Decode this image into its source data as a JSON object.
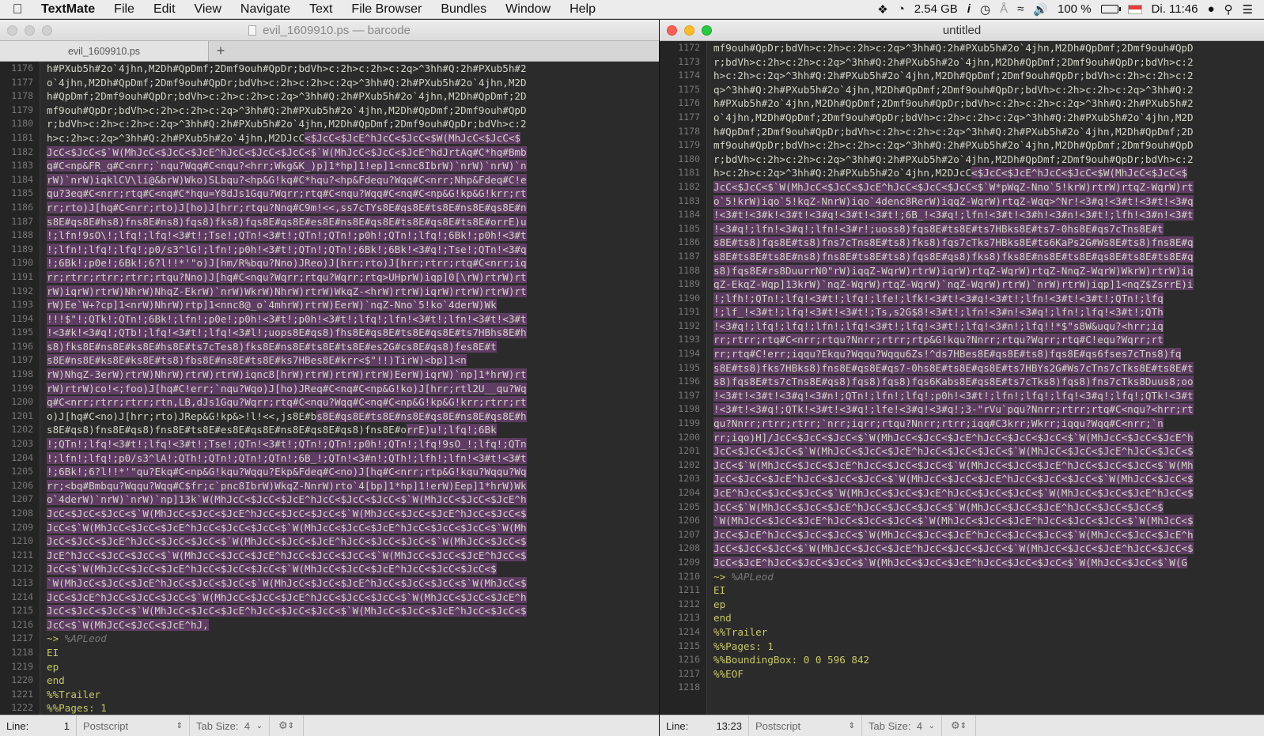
{
  "menubar": {
    "apple": "",
    "app_name": "TextMate",
    "items": [
      "File",
      "Edit",
      "View",
      "Navigate",
      "Text",
      "File Browser",
      "Bundles",
      "Window",
      "Help"
    ],
    "status": {
      "memory": "2.54 GB",
      "battery_pct": "100 %",
      "clock": "Di. 11:46"
    }
  },
  "left_window": {
    "title": "evil_1609910.ps — barcode",
    "tab_label": "evil_1609910.ps",
    "tab_add": "+",
    "line_numbers": [
      "1176",
      "1177",
      "1178",
      "1179",
      "1180",
      "1181",
      "1182",
      "1183",
      "1184",
      "1185",
      "1186",
      "1187",
      "1188",
      "1189",
      "1190",
      "1191",
      "1192",
      "1193",
      "1194",
      "1195",
      "1196",
      "1197",
      "1198",
      "1199",
      "1200",
      "1201",
      "1202",
      "1203",
      "1204",
      "1205",
      "1206",
      "1207",
      "1208",
      "1209",
      "1210",
      "1211",
      "1212",
      "1213",
      "1214",
      "1215",
      "1216",
      "1217",
      "1218",
      "1219",
      "1220",
      "1221",
      "1222"
    ],
    "lines": [
      {
        "t": "h#PXub5h#2o`4jhn,M2Dh#QpDmf;2Dmf9ouh#QpDr;bdVh>c:2h>c:2h>c:2q>^3hh#Q:2h#PXub5h#2",
        "k": "n"
      },
      {
        "t": "o`4jhn,M2Dh#QpDmf;2Dmf9ouh#QpDr;bdVh>c:2h>c:2h>c:2q>^3hh#Q:2h#PXub5h#2o`4jhn,M2D",
        "k": "n"
      },
      {
        "t": "h#QpDmf;2Dmf9ouh#QpDr;bdVh>c:2h>c:2h>c:2q>^3hh#Q:2h#PXub5h#2o`4jhn,M2Dh#QpDmf;2D",
        "k": "n"
      },
      {
        "t": "mf9ouh#QpDr;bdVh>c:2h>c:2h>c:2q>^3hh#Q:2h#PXub5h#2o`4jhn,M2Dh#QpDmf;2Dmf9ouh#QpD",
        "k": "n"
      },
      {
        "t": "r;bdVh>c:2h>c:2h>c:2q>^3hh#Q:2h#PXub5h#2o`4jhn,M2Dh#QpDmf;2Dmf9ouh#QpDr;bdVh>c:2",
        "k": "n"
      },
      {
        "t": "h>c:2h>c:2q>^3hh#Q:2h#PXub5h#2o`4jhn,M2DJcC<$JcC<$JcE^hJcC<$JcC<$W(MhJcC<$JcC<$",
        "k": "p",
        "s": 43
      },
      {
        "t": "JcC<$JcC<$`W(MhJcC<$JcC<$JcE^hJcC<$JcC<$JcC<$`W(MhJcC<$JcC<$JcE^hdJrtAq#C*hq#Bmb",
        "k": "s"
      },
      {
        "t": "q#C<np&FR_q#C<nrr;`nqu?Wqq#C<nqu?<hrr;Wkg&K_)p]1*hp]1!ep]1<nnc8IbrW)`nrW)`nrW)`n",
        "k": "s"
      },
      {
        "t": "rW)`nrW)iqklCV\\li@&brW)Wko)SLbqu?<hp&G!kq#C*hqu?<hp&Fdequ?Wqq#C<nrr;Nhp&Fdeq#C!e",
        "k": "s"
      },
      {
        "t": "qu?3eq#C<nrr;rtq#C<nq#C*hqu=Y8dJs1Gqu?Wqrr;rtq#C<nqu?Wqq#C<nq#C<np&G!kp&G!krr;rt",
        "k": "s"
      },
      {
        "t": "rr;rto)J[hq#C<nrr;rto)J[ho)J[hrr;rtqu?Nnq#C9m!<<,ss7cTYs8E#qs8E#ts8E#ns8E#qs8E#n",
        "k": "s"
      },
      {
        "t": "s8E#qs8E#hs8)fns8E#ns8)fqs8)fks8)fqs8E#qs8E#es8E#ns8E#qs8E#ts8E#qs8E#ts8E#orrE)u",
        "k": "s"
      },
      {
        "t": "!;lfn!9sO\\!;lfq!;lfq!<3#t!;Tse!;QTn!<3#t!;QTn!;QTn!;p0h!;QTn!;lfq!;6Bk!;p0h!<3#t",
        "k": "s"
      },
      {
        "t": "!;lfn!;lfq!;lfq!;p0/s3^lG!;lfn!;p0h!<3#t!;QTn!;QTn!;6Bk!;6Bk!<3#q!;Tse!;QTn!<3#q",
        "k": "s"
      },
      {
        "t": "!;6Bk!;p0e!;6Bk!;6?l!!*'\"o)J[hm/R%bqu?Nno)JReo)J[hrr;rto)J[hrr;rtrr;rtq#C<nrr;iq",
        "k": "s"
      },
      {
        "t": "rr;rtrr;rtrr;rtrr;rtqu?Nno)J[hq#C<nqu?Wqrr;rtqu?Wqrr;rtq>UHprW)iqp]0[\\rW)rtrW)rt",
        "k": "s"
      },
      {
        "t": "rW)iqrW)rtrW)NhrW)NhqZ-EkrW)`nrW)WkrW)NhrW)rtrW)WkqZ-<hrW)rtrW)iqrW)rtrW)rtrW)rt",
        "k": "s"
      },
      {
        "t": "rW)Ee`W+?cp]1<nrW)NhrW)rtp]1<nnc8@_o`4mhrW)rtrW)EerW)`nqZ-Nno`5!ko`4derW)Wk",
        "k": "s"
      },
      {
        "t": "!!!$\"!;QTk!;QTn!;6Bk!;lfn!;p0e!;p0h!<3#t!;p0h!<3#t!;lfq!;lfn!<3#t!;lfn!<3#t!<3#t",
        "k": "s"
      },
      {
        "t": "!<3#k!<3#q!;QTb!;lfq!<3#t!;lfq!<3#l!;uops8E#qs8)fhs8E#qs8E#ts8E#qs8E#ts7HBhs8E#h",
        "k": "s"
      },
      {
        "t": "s8)fks8E#ns8E#ks8E#hs8E#ts7cTes8)fks8E#ns8E#ts8E#ts8E#es2G#cs8E#qs8)fes8E#t",
        "k": "s"
      },
      {
        "t": "s8E#ns8E#ks8E#ks8E#ts8)fbs8E#ns8E#ts8E#ks7HBes8E#krr<$\"!!)TirW)<bp]1<n",
        "k": "s"
      },
      {
        "t": "rW)NhqZ-3erW)rtrW)NhrW)rtrW)rtrW)iqnc8[hrW)rtrW)rtrW)rtrW)EerW)iqrW)`np]1*hrW)rt",
        "k": "s"
      },
      {
        "t": "rW)rtrW)co!<;foo)J[hq#C!err;`nqu?Wqo)J[ho)JReq#C<nq#C<np&G!ko)J[hrr;rtl2U__qu?Wq",
        "k": "s"
      },
      {
        "t": "q#C<nrr;rtrr;rtrr;rtn,LB,dJs1Gqu?Wqrr;rtq#C<nqu?Wqq#C<nq#C<np&G!kp&G!krr;rtrr;rt",
        "k": "s"
      },
      {
        "t": "o)J[hq#C<no)J[hrr;rto)JRep&G!kp&>!l!<<,js8E#bs8E#qs8E#ts8E#ns8E#qs8E#ns8E#qs8E#h",
        "k": "p",
        "s": 45
      },
      {
        "t": "s8E#qs8)fns8E#qs8)fns8E#ts8E#es8E#qs8E#ns8E#qs8E#qs8)fns8E#orrE)u!;lfq!;6Bk",
        "k": "p",
        "s": 60
      },
      {
        "t": "!;QTn!;lfq!<3#t!;lfq!<3#t!;Tse!;QTn!<3#t!;QTn!;QTn!;p0h!;QTn!;lfq!9sO_!;lfq!;QTn",
        "k": "s"
      },
      {
        "t": "!;lfn!;lfq!;p0/s3^lA!;QTh!;QTn!;QTn!;QTn!;6B_!;QTn!<3#n!;QTh!;lfh!;lfn!<3#t!<3#t",
        "k": "s"
      },
      {
        "t": "!;6Bk!;6?l!!*'\"qu?Ekq#C<np&G!kqu?Wqqu?Ekp&Fdeq#C<no)J[hq#C<nrr;rtp&G!kqu?Wqqu?Wq",
        "k": "s"
      },
      {
        "t": "rr;<bq#Bmbqu?Wqqu?Wqq#C$fr;c`pnc8IbrW)WkqZ-NnrW)rto`4[bp]1*hp]1!erW)Eep]1*hrW)Wk",
        "k": "s"
      },
      {
        "t": "o`4derW)`nrW)`nrW)`np]13k`W(MhJcC<$JcC<$JcE^hJcC<$JcC<$JcC<$`W(MhJcC<$JcC<$JcE^h",
        "k": "s"
      },
      {
        "t": "JcC<$JcC<$JcC<$`W(MhJcC<$JcC<$JcE^hJcC<$JcC<$JcC<$`W(MhJcC<$JcC<$JcE^hJcC<$JcC<$",
        "k": "s"
      },
      {
        "t": "JcC<$`W(MhJcC<$JcC<$JcE^hJcC<$JcC<$JcC<$`W(MhJcC<$JcC<$JcE^hJcC<$JcC<$JcC<$`W(Mh",
        "k": "s"
      },
      {
        "t": "JcC<$JcC<$JcE^hJcC<$JcC<$JcC<$`W(MhJcC<$JcC<$JcE^hJcC<$JcC<$JcC<$`W(MhJcC<$JcC<$",
        "k": "s"
      },
      {
        "t": "JcE^hJcC<$JcC<$JcC<$`W(MhJcC<$JcC<$JcE^hJcC<$JcC<$JcC<$`W(MhJcC<$JcC<$JcE^hJcC<$",
        "k": "s"
      },
      {
        "t": "JcC<$`W(MhJcC<$JcC<$JcE^hJcC<$JcC<$JcC<$`W(MhJcC<$JcC<$JcE^hJcC<$JcC<$JcC<$",
        "k": "s"
      },
      {
        "t": "`W(MhJcC<$JcC<$JcE^hJcC<$JcC<$JcC<$`W(MhJcC<$JcC<$JcE^hJcC<$JcC<$JcC<$`W(MhJcC<$",
        "k": "s"
      },
      {
        "t": "JcC<$JcE^hJcC<$JcC<$JcC<$`W(MhJcC<$JcC<$JcE^hJcC<$JcC<$JcC<$`W(MhJcC<$JcC<$JcE^h",
        "k": "s"
      },
      {
        "t": "JcC<$JcC<$JcC<$`W(MhJcC<$JcC<$JcE^hJcC<$JcC<$JcC<$`W(MhJcC<$JcC<$JcE^hJcC<$JcC<$",
        "k": "s"
      },
      {
        "t": "JcC<$`W(MhJcC<$JcC<$JcE^hJ,",
        "k": "s"
      },
      {
        "t": "~> %APLeod",
        "k": "c"
      },
      {
        "t": "EI",
        "k": "w"
      },
      {
        "t": "ep",
        "k": "w"
      },
      {
        "t": "end",
        "k": "w"
      },
      {
        "t": "%%Trailer",
        "k": "w"
      },
      {
        "t": "%%Pages: 1",
        "k": "w"
      }
    ],
    "status": {
      "line_label": "Line:",
      "line_value": "1",
      "language": "Postscript",
      "tab_size": "Tab Size:",
      "tab_value": "4"
    }
  },
  "right_window": {
    "title": "untitled",
    "line_numbers": [
      "1172",
      "1173",
      "1174",
      "1175",
      "1176",
      "1177",
      "1178",
      "1179",
      "1180",
      "1181",
      "1182",
      "1183",
      "1184",
      "1185",
      "1186",
      "1187",
      "1188",
      "1189",
      "1190",
      "1191",
      "1192",
      "1193",
      "1194",
      "1195",
      "1196",
      "1197",
      "1198",
      "1199",
      "1200",
      "1201",
      "1202",
      "1203",
      "1204",
      "1205",
      "1206",
      "1207",
      "1208",
      "1209",
      "1210",
      "1211",
      "1212",
      "1213",
      "1214",
      "1215",
      "1216",
      "1217",
      "1218"
    ],
    "lines": [
      {
        "t": "mf9ouh#QpDr;bdVh>c:2h>c:2h>c:2q>^3hh#Q:2h#PXub5h#2o`4jhn,M2Dh#QpDmf;2Dmf9ouh#QpD",
        "k": "n"
      },
      {
        "t": "r;bdVh>c:2h>c:2h>c:2q>^3hh#Q:2h#PXub5h#2o`4jhn,M2Dh#QpDmf;2Dmf9ouh#QpDr;bdVh>c:2",
        "k": "n"
      },
      {
        "t": "h>c:2h>c:2q>^3hh#Q:2h#PXub5h#2o`4jhn,M2Dh#QpDmf;2Dmf9ouh#QpDr;bdVh>c:2h>c:2h>c:2",
        "k": "n"
      },
      {
        "t": "q>^3hh#Q:2h#PXub5h#2o`4jhn,M2Dh#QpDmf;2Dmf9ouh#QpDr;bdVh>c:2h>c:2h>c:2q>^3hh#Q:2",
        "k": "n"
      },
      {
        "t": "h#PXub5h#2o`4jhn,M2Dh#QpDmf;2Dmf9ouh#QpDr;bdVh>c:2h>c:2h>c:2q>^3hh#Q:2h#PXub5h#2",
        "k": "n"
      },
      {
        "t": "o`4jhn,M2Dh#QpDmf;2Dmf9ouh#QpDr;bdVh>c:2h>c:2h>c:2q>^3hh#Q:2h#PXub5h#2o`4jhn,M2D",
        "k": "n"
      },
      {
        "t": "h#QpDmf;2Dmf9ouh#QpDr;bdVh>c:2h>c:2h>c:2q>^3hh#Q:2h#PXub5h#2o`4jhn,M2Dh#QpDmf;2D",
        "k": "n"
      },
      {
        "t": "mf9ouh#QpDr;bdVh>c:2h>c:2h>c:2q>^3hh#Q:2h#PXub5h#2o`4jhn,M2Dh#QpDmf;2Dmf9ouh#QpD",
        "k": "n"
      },
      {
        "t": "r;bdVh>c:2h>c:2h>c:2q>^3hh#Q:2h#PXub5h#2o`4jhn,M2Dh#QpDmf;2Dmf9ouh#QpDr;bdVh>c:2",
        "k": "n"
      },
      {
        "t": "h>c:2h>c:2q>^3hh#Q:2h#PXub5h#2o`4jhn,M2DJcC<$JcC<$JcE^hJcC<$JcC<$W(MhJcC<$JcC<$",
        "k": "p",
        "s": 43
      },
      {
        "t": "JcC<$JcC<$`W(MhJcC<$JcC<$JcE^hJcC<$JcC<$JcC<$`W*pWqZ-Nno`5!krW)rtrW)rtqZ-WqrW)rt",
        "k": "s"
      },
      {
        "t": "o`5!krW)iqo`5!kqZ-NnrW)iqo`4denc8RerW)iqqZ-WqrW)rtqZ-Wqq>^Nr!<3#q!<3#t!<3#t!<3#q",
        "k": "s"
      },
      {
        "t": "!<3#t!<3#k!<3#t!<3#q!<3#t!<3#t!;6B_!<3#q!;lfn!<3#t!<3#h!<3#n!<3#t!;lfh!<3#n!<3#t",
        "k": "s"
      },
      {
        "t": "!<3#q!;lfn!<3#q!;lfn!<3#r!;uoss8)fqs8E#ts8E#ts7HBks8E#ts7-0hs8E#qs7cTns8E#t",
        "k": "s"
      },
      {
        "t": "s8E#ts8)fqs8E#ts8)fns7cTns8E#ts8)fks8)fqs7cTks7HBks8E#ts6KaPs2G#Ws8E#ts8)fns8E#q",
        "k": "s"
      },
      {
        "t": "s8E#ts8E#ts8E#ns8)fns8E#ts8E#ts8)fqs8E#qs8)fks8)fks8E#ns8E#ts8E#qs8E#ts8E#ts8E#q",
        "k": "s"
      },
      {
        "t": "s8)fqs8E#rs8DuurrN0\"rW)iqqZ-WqrW)rtrW)iqrW)rtqZ-WqrW)rtqZ-NnqZ-WqrW)WkrW)rtrW)iq",
        "k": "s"
      },
      {
        "t": "qZ-EkqZ-Wqp]13krW)`nqZ-WqrW)rtqZ-WqrW)`nqZ-WqrW)rtrW)`nrW)rtrW)iqp]1<nqZ$ZsrrE)i",
        "k": "s"
      },
      {
        "t": "!;lfh!;QTn!;lfq!<3#t!;lfq!;lfe!;lfk!<3#t!<3#q!<3#t!;lfn!<3#t!<3#t!;QTn!;lfq",
        "k": "s"
      },
      {
        "t": "!;lf_!<3#t!;lfq!<3#t!<3#t!;Ts,s2G$8!<3#t!;lfn!<3#n!<3#q!;lfn!;lfq!<3#t!;QTh",
        "k": "s"
      },
      {
        "t": "!<3#q!;lfq!;lfq!;lfn!;lfq!<3#t!;lfq!<3#t!;lfq!<3#n!;lfq!!*$\"s8W&uqu?<hrr;iq",
        "k": "s"
      },
      {
        "t": "rr;rtrr;rtq#C<nrr;rtqu?Nnrr;rtrr;rtp&G!kqu?Nnrr;rtqu?Wqrr;rtq#C!equ?Wqrr;rt",
        "k": "s"
      },
      {
        "t": "rr;rtq#C!err;iqqu?Ekqu?Wqqu?Wqqu6Zs!^ds7HBes8E#qs8E#ts8)fqs8E#qs6fses7cTns8)fq",
        "k": "s"
      },
      {
        "t": "s8E#ts8)fks7HBks8)fns8E#qs8E#qs7-0hs8E#ts8E#qs8E#ts7HBYs2G#Ws7cTns7cTks8E#ts8E#t",
        "k": "s"
      },
      {
        "t": "s8)fqs8E#ts7cTns8E#qs8)fqs8)fqs8)fqs6Kabs8E#qs8E#ts7cTks8)fqs8)fns7cTks8Duus8;oo",
        "k": "s"
      },
      {
        "t": "!<3#t!<3#t!<3#q!<3#n!;QTn!;lfn!;lfq!;p0h!<3#t!;lfn!;lfq!;lfq!<3#q!;lfq!;QTk!<3#t",
        "k": "s"
      },
      {
        "t": "!<3#t!<3#q!;QTk!<3#t!<3#q!;lfe!<3#q!<3#q!;3-\"rVu`pqu?Nnrr;rtrr;rtq#C<nqu?<hrr;rt",
        "k": "s"
      },
      {
        "t": "qu?Nnrr;rtrr;rtrr;`nrr;iqrr;rtqu?Nnrr;rtrr;iqq#C3krr;Wkrr;iqqu?Wqq#C<nrr;`n",
        "k": "s"
      },
      {
        "t": "rr;iqo)H]/JcC<$JcC<$JcC<$`W(MhJcC<$JcC<$JcE^hJcC<$JcC<$JcC<$`W(MhJcC<$JcC<$JcE^h",
        "k": "s"
      },
      {
        "t": "JcC<$JcC<$JcC<$`W(MhJcC<$JcC<$JcE^hJcC<$JcC<$JcC<$`W(MhJcC<$JcC<$JcE^hJcC<$JcC<$",
        "k": "s"
      },
      {
        "t": "JcC<$`W(MhJcC<$JcC<$JcE^hJcC<$JcC<$JcC<$`W(MhJcC<$JcC<$JcE^hJcC<$JcC<$JcC<$`W(Mh",
        "k": "s"
      },
      {
        "t": "JcC<$JcC<$JcE^hJcC<$JcC<$JcC<$`W(MhJcC<$JcC<$JcE^hJcC<$JcC<$JcC<$`W(MhJcC<$JcC<$",
        "k": "s"
      },
      {
        "t": "JcE^hJcC<$JcC<$JcC<$`W(MhJcC<$JcC<$JcE^hJcC<$JcC<$JcC<$`W(MhJcC<$JcC<$JcE^hJcC<$",
        "k": "s"
      },
      {
        "t": "JcC<$`W(MhJcC<$JcC<$JcE^hJcC<$JcC<$JcC<$`W(MhJcC<$JcC<$JcE^hJcC<$JcC<$JcC<$",
        "k": "s"
      },
      {
        "t": "`W(MhJcC<$JcC<$JcE^hJcC<$JcC<$JcC<$`W(MhJcC<$JcC<$JcE^hJcC<$JcC<$JcC<$`W(MhJcC<$",
        "k": "s"
      },
      {
        "t": "JcC<$JcE^hJcC<$JcC<$JcC<$`W(MhJcC<$JcC<$JcE^hJcC<$JcC<$JcC<$`W(MhJcC<$JcC<$JcE^h",
        "k": "s"
      },
      {
        "t": "JcC<$JcC<$JcC<$`W(MhJcC<$JcC<$JcE^hJcC<$JcC<$JcC<$`W(MhJcC<$JcC<$JcE^hJcC<$JcC<$",
        "k": "s"
      },
      {
        "t": "JcC<$JcE^hJcC<$JcC<$JcC<$`W(MhJcC<$JcC<$JcE^hJcC<$JcC<$JcC<$`W(MhJcC<$JcC<$`W(G",
        "k": "s"
      },
      {
        "t": "~> %APLeod",
        "k": "c"
      },
      {
        "t": "EI",
        "k": "w"
      },
      {
        "t": "ep",
        "k": "w"
      },
      {
        "t": "end",
        "k": "w"
      },
      {
        "t": "%%Trailer",
        "k": "w"
      },
      {
        "t": "%%Pages: 1",
        "k": "w"
      },
      {
        "t": "%%BoundingBox: 0 0 596 842",
        "k": "w"
      },
      {
        "t": "%%EOF",
        "k": "w"
      },
      {
        "t": "",
        "k": "w"
      }
    ],
    "status": {
      "line_label": "Line:",
      "line_value": "13:23",
      "language": "Postscript",
      "tab_size": "Tab Size:",
      "tab_value": "4"
    }
  },
  "colors": {
    "selection": "#5f3d63",
    "editor_bg": "#2b2b2b",
    "text": "#d4d4c8",
    "keyword": "#c8c86a"
  }
}
